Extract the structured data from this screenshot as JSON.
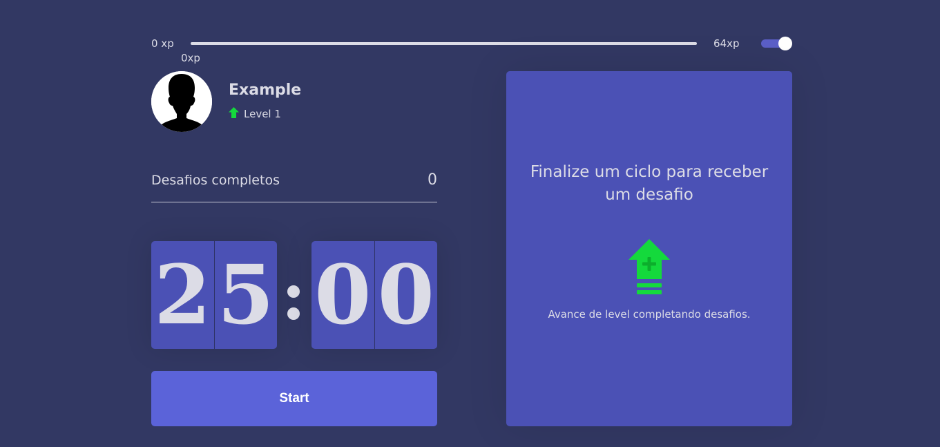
{
  "xp_bar": {
    "min_label": "0 xp",
    "current_label": "0xp",
    "max_label": "64xp",
    "progress_fraction": 0
  },
  "theme_toggle": {
    "state": "on",
    "accent": "#5b5fc7"
  },
  "profile": {
    "name": "Example",
    "level": "Level 1",
    "level_icon": "level-up-arrow-icon"
  },
  "challenges": {
    "label": "Desafios completos",
    "count": "0"
  },
  "countdown": {
    "minutes": [
      "2",
      "5"
    ],
    "seconds": [
      "0",
      "0"
    ]
  },
  "start_button": {
    "label": "Start"
  },
  "challenge_panel": {
    "title": "Finalize um ciclo para receber um desafio",
    "description": "Avance de level completando desafios.",
    "icon": "level-up-icon"
  },
  "colors": {
    "background": "#323863",
    "card": "#4b51b5",
    "button": "#5b63d9",
    "level_green": "#14d93c"
  }
}
